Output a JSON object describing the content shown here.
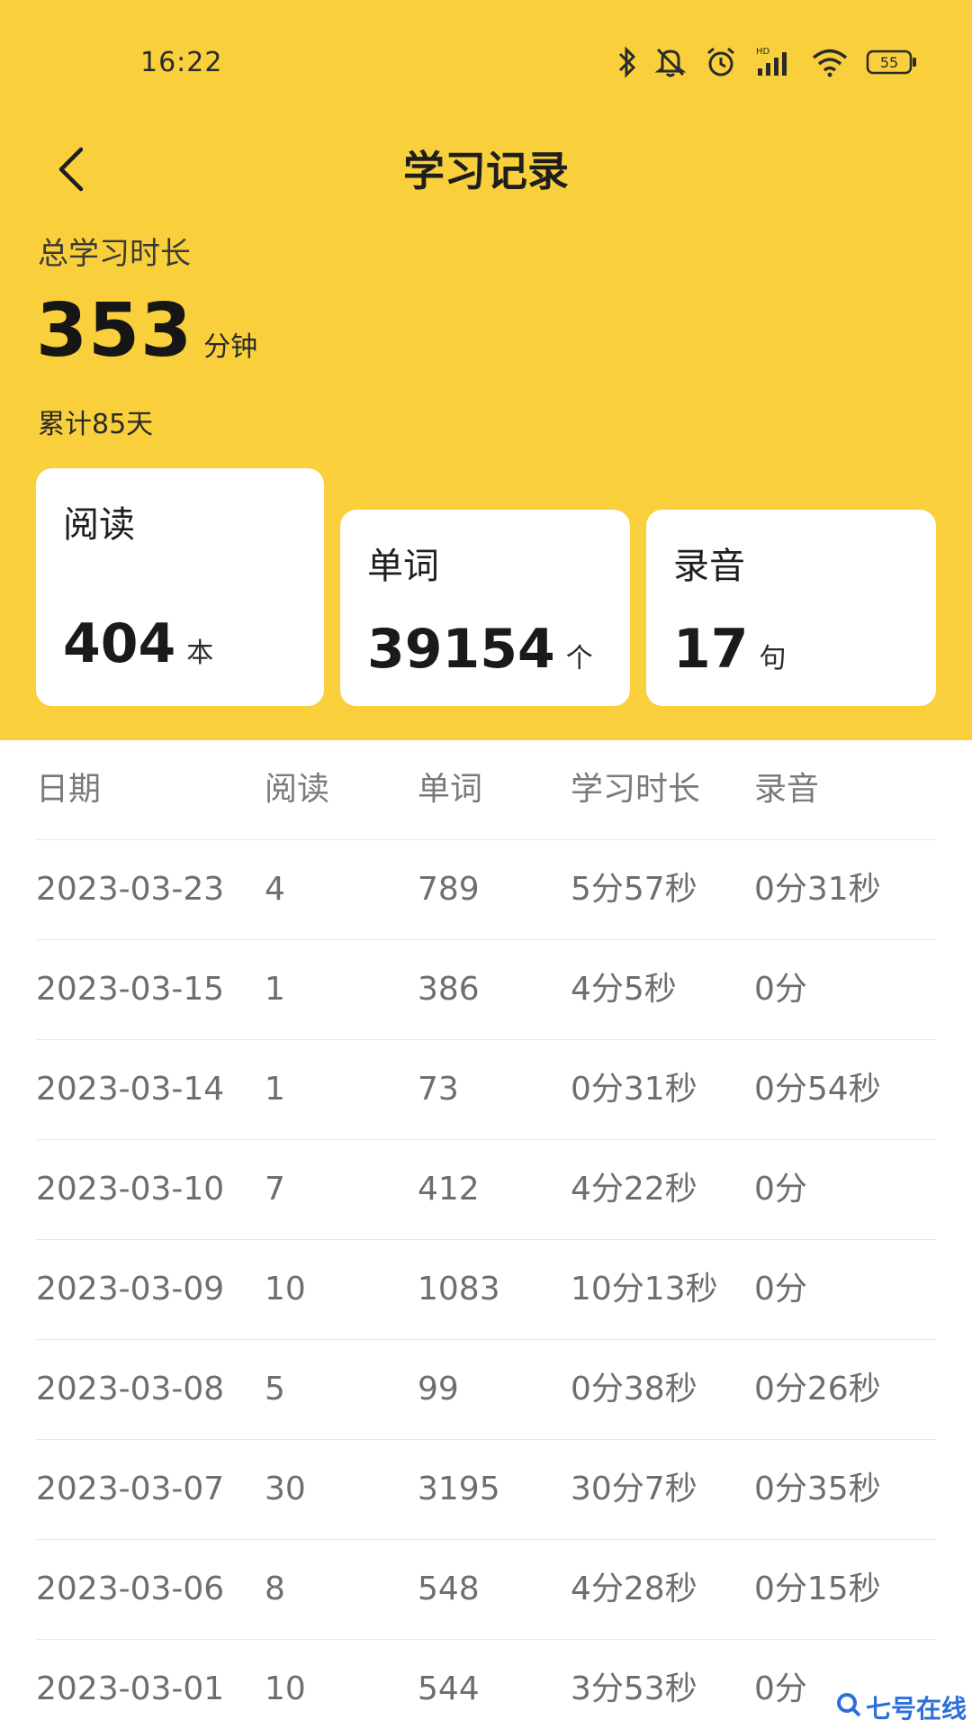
{
  "status_bar": {
    "time": "16:22",
    "battery": "55",
    "icons": [
      "bluetooth-icon",
      "mute-icon",
      "alarm-icon",
      "hd-signal-icon",
      "wifi-icon",
      "battery-icon"
    ]
  },
  "nav": {
    "title": "学习记录",
    "back_icon": "chevron-left-icon"
  },
  "summary": {
    "total_label": "总学习时长",
    "total_value": "353",
    "total_unit": "分钟",
    "days_label": "累计85天"
  },
  "cards": {
    "reading": {
      "title": "阅读",
      "value": "404",
      "unit": "本"
    },
    "words": {
      "title": "单词",
      "value": "39154",
      "unit": "个"
    },
    "recording": {
      "title": "录音",
      "value": "17",
      "unit": "句"
    }
  },
  "table": {
    "headers": {
      "date": "日期",
      "reading": "阅读",
      "words": "单词",
      "time": "学习时长",
      "recording": "录音"
    },
    "rows": [
      {
        "date": "2023-03-23",
        "reading": "4",
        "words": "789",
        "time": "5分57秒",
        "recording": "0分31秒"
      },
      {
        "date": "2023-03-15",
        "reading": "1",
        "words": "386",
        "time": "4分5秒",
        "recording": "0分"
      },
      {
        "date": "2023-03-14",
        "reading": "1",
        "words": "73",
        "time": "0分31秒",
        "recording": "0分54秒"
      },
      {
        "date": "2023-03-10",
        "reading": "7",
        "words": "412",
        "time": "4分22秒",
        "recording": "0分"
      },
      {
        "date": "2023-03-09",
        "reading": "10",
        "words": "1083",
        "time": "10分13秒",
        "recording": "0分"
      },
      {
        "date": "2023-03-08",
        "reading": "5",
        "words": "99",
        "time": "0分38秒",
        "recording": "0分26秒"
      },
      {
        "date": "2023-03-07",
        "reading": "30",
        "words": "3195",
        "time": "30分7秒",
        "recording": "0分35秒"
      },
      {
        "date": "2023-03-06",
        "reading": "8",
        "words": "548",
        "time": "4分28秒",
        "recording": "0分15秒"
      },
      {
        "date": "2023-03-01",
        "reading": "10",
        "words": "544",
        "time": "3分53秒",
        "recording": "0分"
      }
    ]
  },
  "watermark": {
    "text": "七号在线"
  },
  "colors": {
    "header_bg": "#f9d03b",
    "card_bg": "#ffffff",
    "text_muted": "#6e6e6e"
  }
}
